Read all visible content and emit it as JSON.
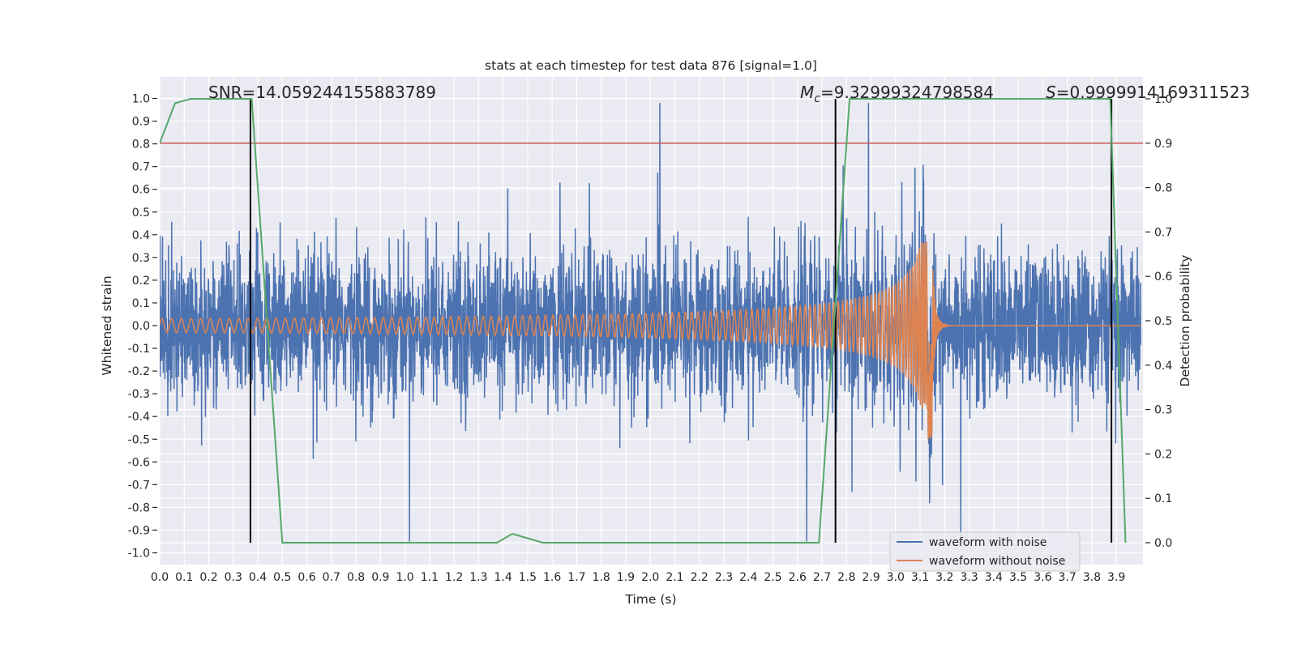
{
  "chart_data": {
    "type": "line",
    "title": "stats at each timestep for test data 876 [signal=1.0]",
    "xlabel": "Time (s)",
    "ylabel": "Whitened strain",
    "y2label": "Detection probability",
    "xlim": [
      0,
      4.0
    ],
    "ylim": [
      -1.05,
      1.1
    ],
    "y2lim": [
      -0.05,
      1.05
    ],
    "grid": true,
    "xticks": [
      "0.0",
      "0.1",
      "0.2",
      "0.3",
      "0.4",
      "0.5",
      "0.6",
      "0.7",
      "0.8",
      "0.9",
      "1.0",
      "1.1",
      "1.2",
      "1.3",
      "1.4",
      "1.5",
      "1.6",
      "1.7",
      "1.8",
      "1.9",
      "2.0",
      "2.1",
      "2.2",
      "2.3",
      "2.4",
      "2.5",
      "2.6",
      "2.7",
      "2.8",
      "2.9",
      "3.0",
      "3.1",
      "3.2",
      "3.3",
      "3.4",
      "3.5",
      "3.6",
      "3.7",
      "3.8",
      "3.9"
    ],
    "yticks": [
      "-1.0",
      "-0.9",
      "-0.8",
      "-0.7",
      "-0.6",
      "-0.5",
      "-0.4",
      "-0.3",
      "-0.2",
      "-0.1",
      "0.0",
      "0.1",
      "0.2",
      "0.3",
      "0.4",
      "0.5",
      "0.6",
      "0.7",
      "0.8",
      "0.9",
      "1.0"
    ],
    "y2ticks": [
      "0.0",
      "0.1",
      "0.2",
      "0.3",
      "0.4",
      "0.5",
      "0.6",
      "0.7",
      "0.8",
      "0.9",
      "1.0"
    ],
    "series": [
      {
        "name": "waveform with noise",
        "axis": "left",
        "color": "#4c72b0"
      },
      {
        "name": "waveform without noise",
        "axis": "left",
        "color": "#dd8452",
        "merger_time": 3.15
      },
      {
        "axis": "right",
        "color": "#55a868",
        "x": [
          0,
          0.0625,
          0.125,
          0.375,
          0.5,
          1.375,
          1.4375,
          1.5625,
          2.6875,
          2.8125,
          3.875,
          3.9375
        ],
        "y": [
          0.9,
          0.99,
          1.0,
          1.0,
          0.0,
          0.0,
          0.02,
          0.0,
          0.0,
          1.0,
          1.0,
          0.0
        ]
      }
    ],
    "threshold": {
      "value": 0.9,
      "axis": "right",
      "color": "#c44e52"
    },
    "vlines": {
      "x": [
        0.37,
        2.755,
        3.88
      ],
      "ymin": 0.0,
      "ymax": 1.0,
      "color": "#000000"
    },
    "annotations": {
      "snr_label": "SNR=",
      "snr": "14.059244155883789",
      "mc_symbol": "M",
      "mc_sub": "c",
      "mc_eq": "=",
      "mc": "9.32999324798584",
      "s_symbol": "S",
      "s_eq": "=",
      "s": "0.9999914169311523"
    },
    "legend": {
      "placement": "lower-right",
      "entries": [
        "waveform with noise",
        "waveform without noise"
      ]
    }
  }
}
